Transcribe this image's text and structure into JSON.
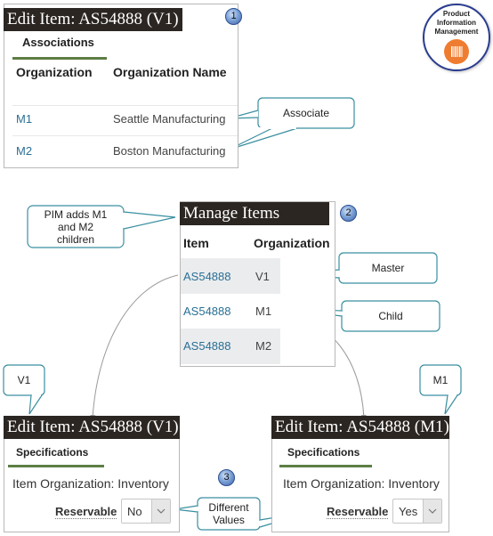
{
  "panel1": {
    "title": "Edit Item: AS54888 (V1)",
    "badge": "1",
    "tab": "Associations",
    "columns": [
      "Organization",
      "Organization Name"
    ],
    "rows": [
      {
        "org": "M1",
        "name": "Seattle Manufacturing"
      },
      {
        "org": "M2",
        "name": "Boston Manufacturing"
      }
    ]
  },
  "logo": {
    "line1": "Product",
    "line2": "Information",
    "line3": "Management",
    "icon": "barcode-icon",
    "accent_color": "#ef7d31",
    "ring_color": "#2a3d8f"
  },
  "callouts": {
    "associate": "Associate",
    "pim_adds_line1": "PIM adds M1",
    "pim_adds_line2": "and M2",
    "pim_adds_line3": "children",
    "master": "Master",
    "child": "Child",
    "v1": "V1",
    "m1": "M1",
    "different_line1": "Different",
    "different_line2": "Values"
  },
  "panel2": {
    "title": "Manage Items",
    "badge": "2",
    "columns": [
      "Item",
      "Organization"
    ],
    "rows": [
      {
        "item": "AS54888",
        "org": "V1"
      },
      {
        "item": "AS54888",
        "org": "M1"
      },
      {
        "item": "AS54888",
        "org": "M2"
      }
    ]
  },
  "panel3": {
    "title": "Edit Item: AS54888 (V1)",
    "tab": "Specifications",
    "org_line": "Item Organization: Inventory",
    "field_label": "Reservable",
    "field_value": "No"
  },
  "badge3": "3",
  "panel4": {
    "title": "Edit Item: AS54888 (M1)",
    "tab": "Specifications",
    "org_line": "Item Organization: Inventory",
    "field_label": "Reservable",
    "field_value": "Yes"
  },
  "colors": {
    "titlebar": "#2b2622",
    "link": "#2a6f94",
    "tab_underline": "#5d7e45",
    "callout_border": "#3a8fa0"
  }
}
